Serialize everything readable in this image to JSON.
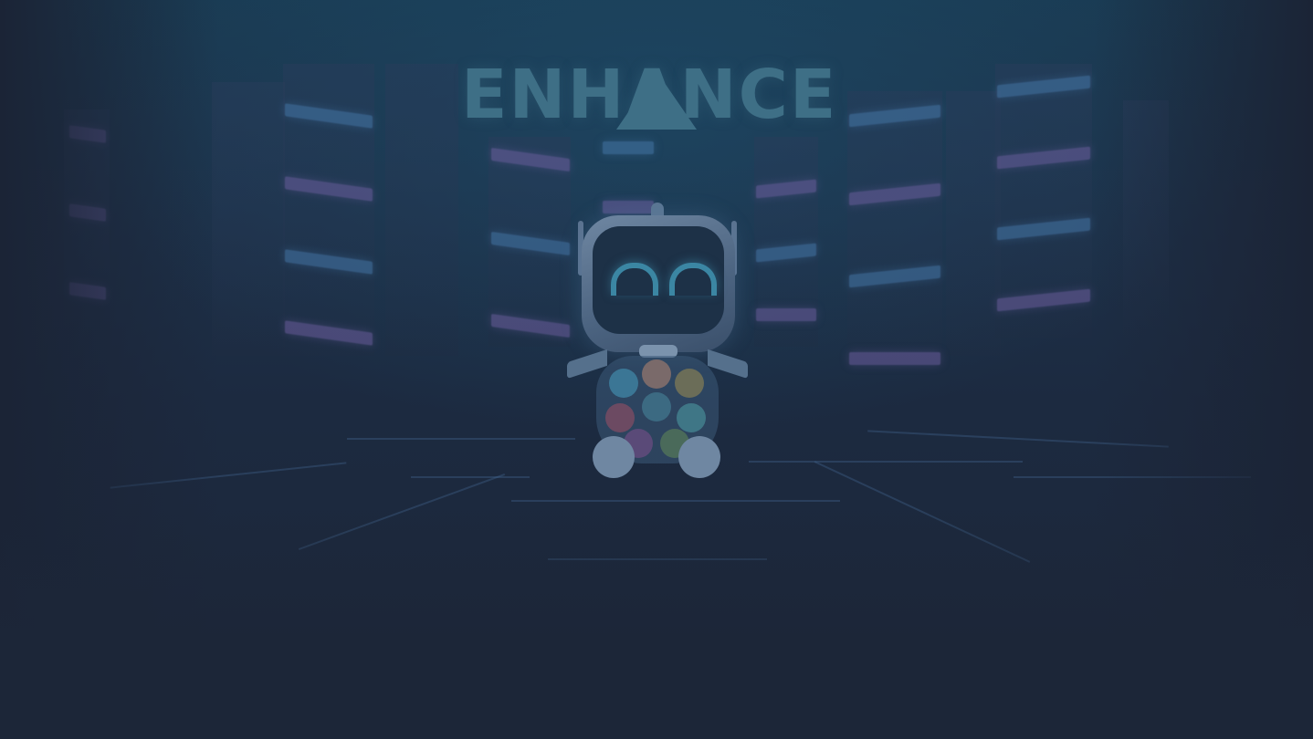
{
  "app": {
    "logo_text": "ENHANCE",
    "mascot": "robot-mascot"
  },
  "colors": {
    "background": "#1c2638",
    "logo": "#3e6f86",
    "accent_blue": "#4678aa",
    "accent_purple": "#6e5fa0"
  },
  "icons": [
    "enhance-logo-triangle-icon",
    "robot-mascot-icon"
  ]
}
